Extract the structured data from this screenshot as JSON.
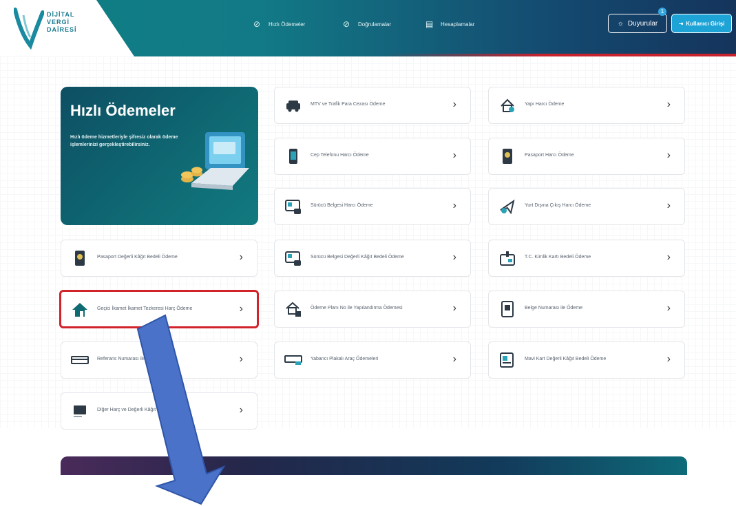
{
  "header": {
    "logo_lines": [
      "DİJİTAL",
      "VERGİ",
      "DAİRESİ"
    ],
    "nav": [
      "Hızlı Ödemeler",
      "Doğrulamalar",
      "Hesaplamalar"
    ],
    "announcements_label": "Duyurular",
    "announcements_count": "1",
    "login_label": "Kullanıcı Girişi"
  },
  "hero": {
    "title": "Hızlı Ödemeler",
    "description": "Hızlı ödeme hizmetleriyle şifresiz olarak ödeme işlemlerinizi gerçekleştirebilirsiniz."
  },
  "cards": [
    {
      "id": "mtv",
      "label": "MTV ve Trafik Para Cezası Ödeme",
      "icon": "car-icon"
    },
    {
      "id": "yapi",
      "label": "Yapı Harcı Ödeme",
      "icon": "house-doc-icon"
    },
    {
      "id": "cep",
      "label": "Cep Telefonu Harcı Ödeme",
      "icon": "phone-icon"
    },
    {
      "id": "pasaport",
      "label": "Pasaport Harcı Ödeme",
      "icon": "passport-icon"
    },
    {
      "id": "surucu",
      "label": "Sürücü Belgesi Harcı Ödeme",
      "icon": "license-icon"
    },
    {
      "id": "yurtdisi",
      "label": "Yurt Dışına Çıkış Harcı Ödeme",
      "icon": "plane-icon"
    },
    {
      "id": "pasaport-kagit",
      "label": "Pasaport Değerli Kâğıt Bedeli Ödeme",
      "icon": "passport-icon"
    },
    {
      "id": "surucu-kagit",
      "label": "Sürücü Belgesi Değerli Kâğıt Bedeli Ödeme",
      "icon": "license-icon"
    },
    {
      "id": "tc-kimlik",
      "label": "T.C. Kimlik Kartı Bedeli Ödeme",
      "icon": "idcard-icon"
    },
    {
      "id": "gecici-ikamet",
      "label": "Geçici İkamet İkamet Tezkeresi Harç Ödeme",
      "icon": "home-icon"
    },
    {
      "id": "odeme-plani",
      "label": "Ödeme Planı No ile Yapılandırma Ödemesi",
      "icon": "plan-icon"
    },
    {
      "id": "belge-no",
      "label": "Belge Numarası ile Ödeme",
      "icon": "document-icon"
    },
    {
      "id": "referans",
      "label": "Referans Numarası ile Ödeme",
      "icon": "card-icon"
    },
    {
      "id": "yabanci-plaka",
      "label": "Yabancı Plakalı Araç Ödemeleri",
      "icon": "plate-icon"
    },
    {
      "id": "mavi-kart",
      "label": "Mavi Kart Değerli Kâğıt Bedeli Ödeme",
      "icon": "bluecard-icon"
    },
    {
      "id": "diger-harc",
      "label": "Diğer Harç ve Değerli Kâğıt Bedeli Ödeme",
      "icon": "other-icon"
    }
  ],
  "colors": {
    "accent": "#127a86",
    "highlight": "#d2232a",
    "arrow": "#4a72c8"
  }
}
